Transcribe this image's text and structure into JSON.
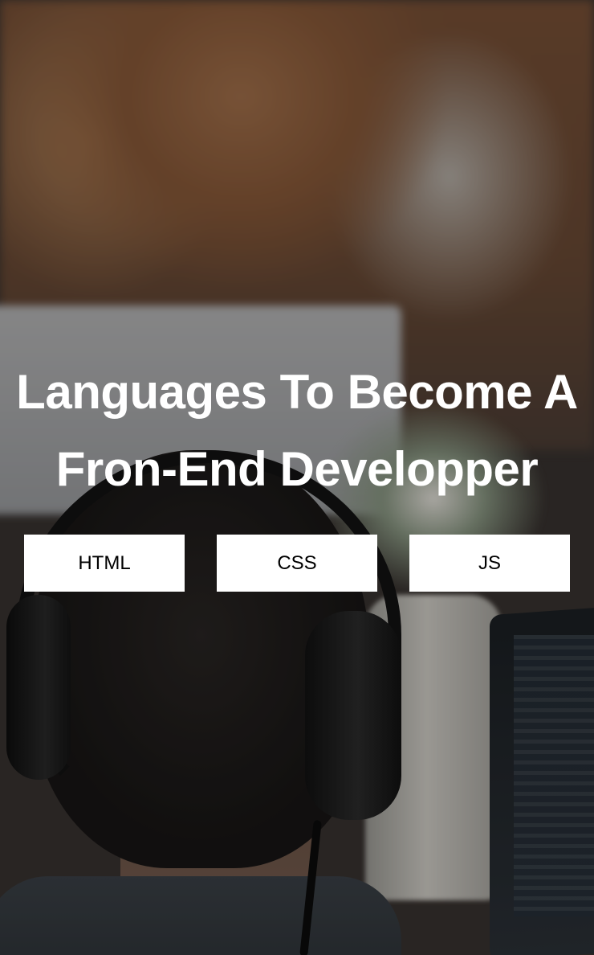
{
  "hero": {
    "background_image": "blurred office photo of person wearing headphones at desk with laptops and flowers",
    "title_line1": "Languages To Become A",
    "title_line2": "Fron-End Developper",
    "title_color": "#ffffff"
  },
  "buttons": [
    {
      "label": "HTML"
    },
    {
      "label": "CSS"
    },
    {
      "label": "JS"
    }
  ],
  "colors": {
    "button_background": "#ffffff",
    "button_text": "#000000"
  }
}
